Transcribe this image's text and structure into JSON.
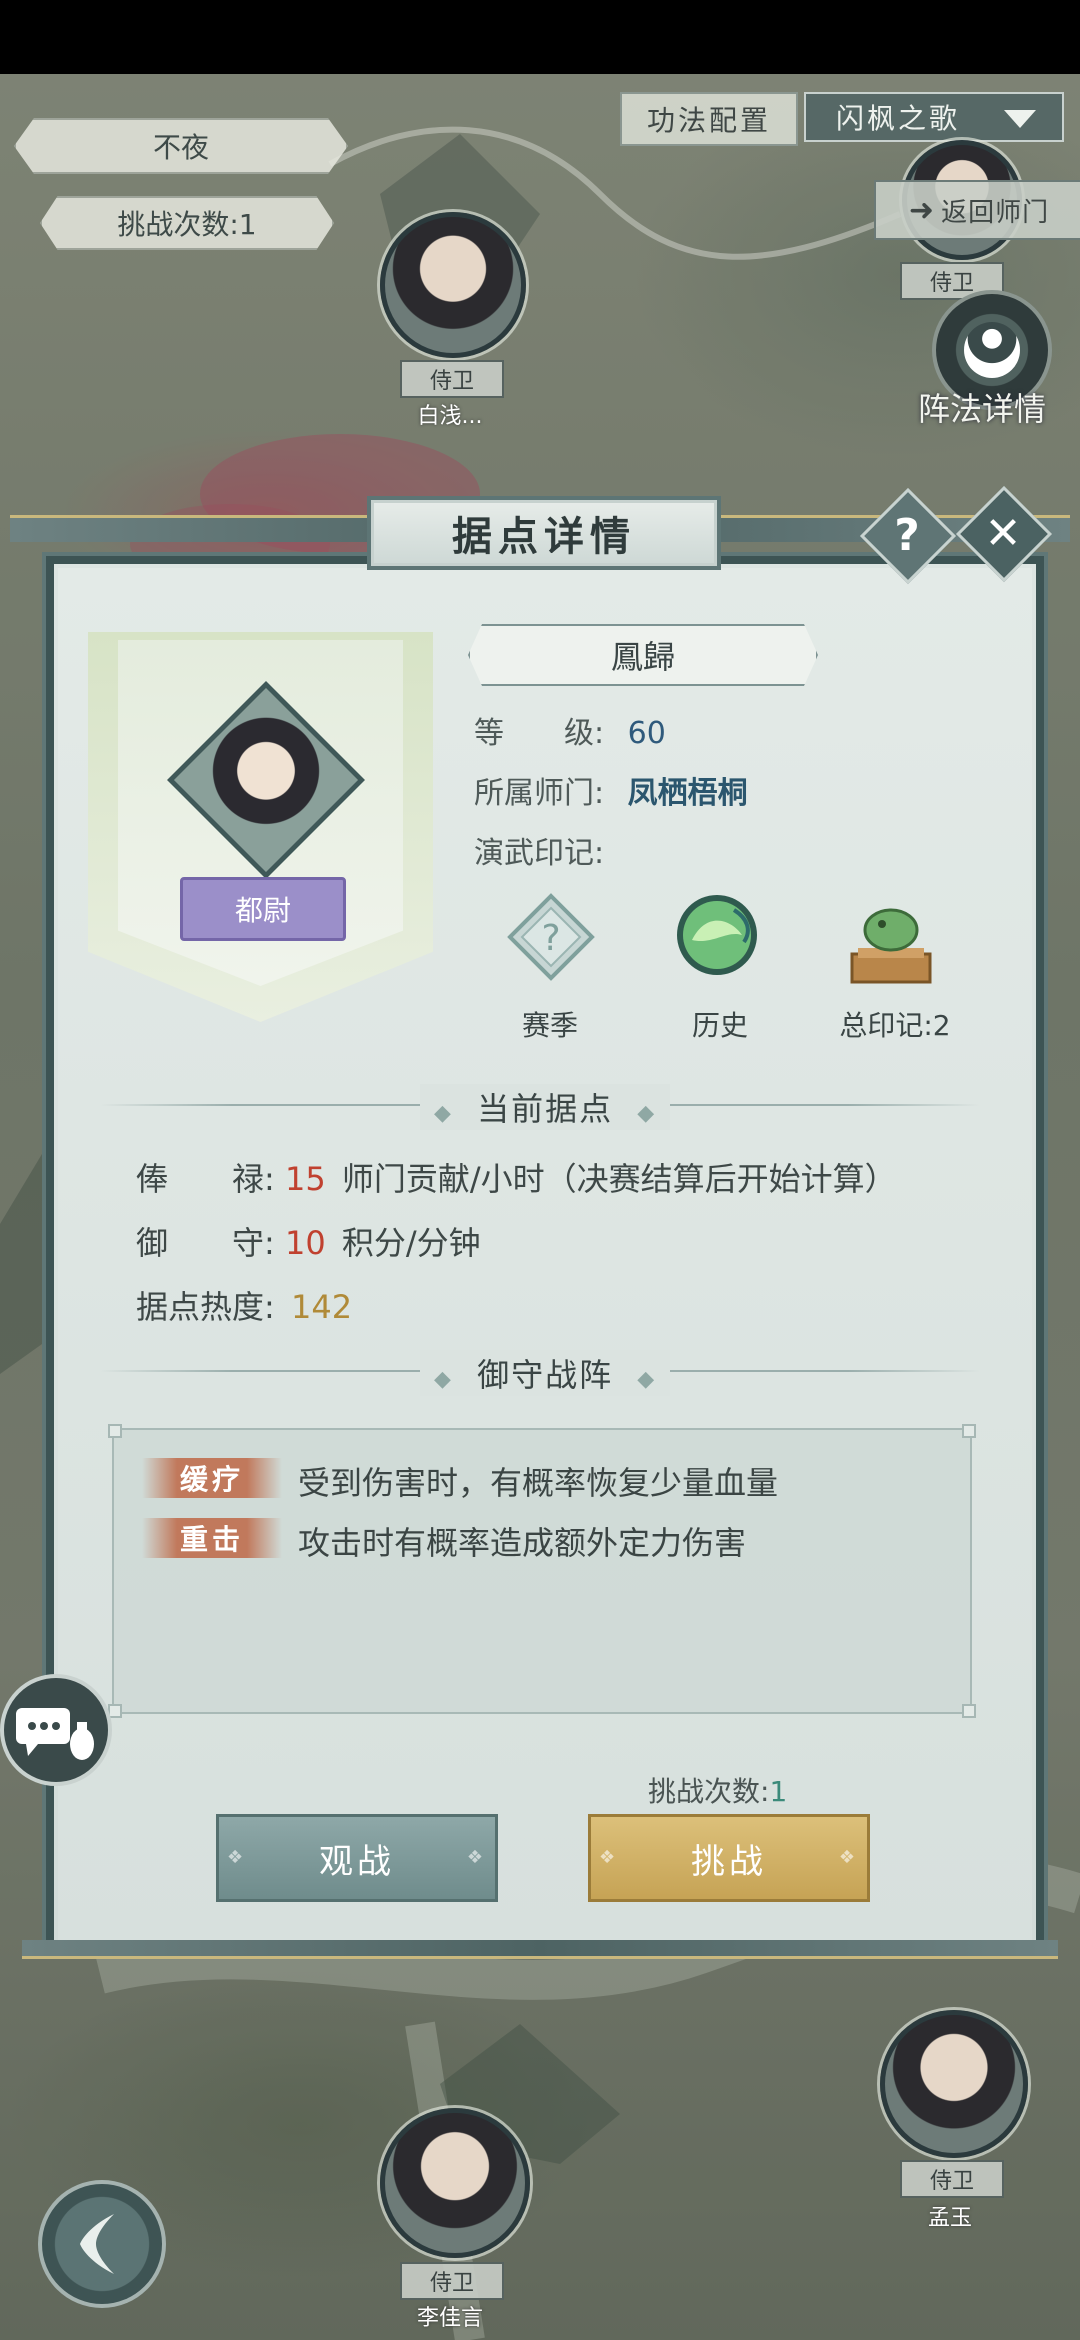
{
  "top_left": {
    "territory_name": "不夜",
    "challenge_count_label": "挑战次数:1"
  },
  "top_right": {
    "skill_config_label": "功法配置",
    "selected_skill": "闪枫之歌",
    "return_label": "返回师门",
    "formation_detail_label": "阵法详情"
  },
  "map_guards": [
    {
      "tag": "侍卫",
      "name": "白浅..."
    },
    {
      "tag": "侍卫",
      "name": ""
    },
    {
      "tag": "侍卫",
      "name": "孟玉"
    },
    {
      "tag": "侍卫",
      "name": "李佳言"
    }
  ],
  "dialog": {
    "title": "据点详情",
    "help_glyph": "?",
    "close_glyph": "✕",
    "rank_badge": "都尉",
    "player_name": "鳳歸",
    "level_label": "等　　级:",
    "level_value": "60",
    "sect_label": "所属师门:",
    "sect_value": "凤栖梧桐",
    "marks_label": "演武印记:",
    "marks": [
      {
        "label": "赛季",
        "icon": "question-diamond-icon"
      },
      {
        "label": "历史",
        "icon": "jade-orb-icon"
      },
      {
        "label": "总印记:2",
        "icon": "bronze-seal-icon"
      }
    ],
    "current_stronghold_title": "当前据点",
    "salary_label": "俸　　禄:",
    "salary_value": "15",
    "salary_unit": "师门贡献/小时（决赛结算后开始计算）",
    "defense_label": "御　　守:",
    "defense_value": "10",
    "defense_unit": "积分/分钟",
    "heat_label": "据点热度:",
    "heat_value": "142",
    "formation_title": "御守战阵",
    "skills": [
      {
        "tag": "缓疗",
        "desc": "受到伤害时，有概率恢复少量血量"
      },
      {
        "tag": "重击",
        "desc": "攻击时有概率造成额外定力伤害"
      }
    ],
    "attempts_label": "挑战次数:",
    "attempts_value": "1",
    "watch_button": "观战",
    "challenge_button": "挑战"
  },
  "colors": {
    "accent_red": "#c0412f",
    "accent_gold": "#b08a38",
    "rank_purple": "#9b8fc9",
    "challenge_gold": "#c6a355",
    "watch_teal": "#6f8c8c"
  }
}
